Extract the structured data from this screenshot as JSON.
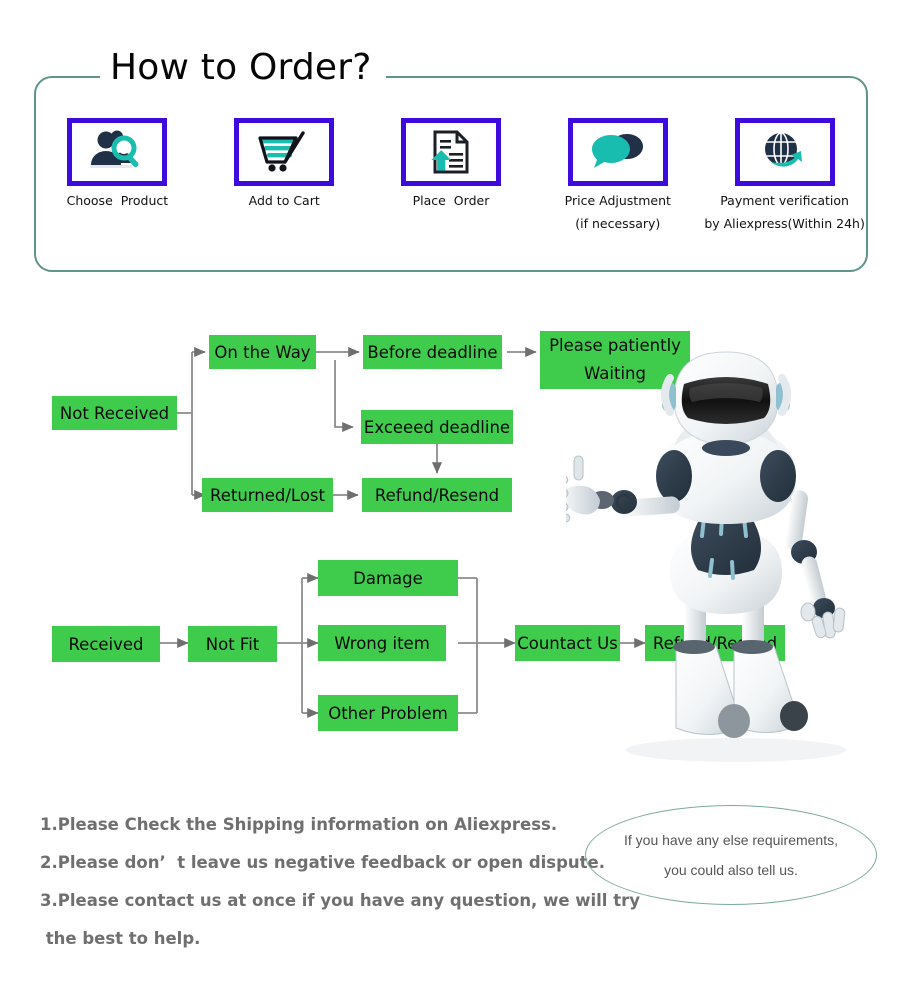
{
  "header": {
    "title": "How to Order?",
    "border_color": "#5f938c",
    "steps": [
      {
        "icon": "person-search-icon",
        "label": "Choose  Product",
        "sub": ""
      },
      {
        "icon": "shopping-cart-icon",
        "label": "Add to Cart",
        "sub": ""
      },
      {
        "icon": "document-upload-icon",
        "label": "Place  Order",
        "sub": ""
      },
      {
        "icon": "chat-bubbles-icon",
        "label": "Price Adjustment",
        "sub": "(if necessary)"
      },
      {
        "icon": "globe-arrow-icon",
        "label": "Payment verification",
        "sub": "by Aliexpress(Within 24h)"
      }
    ],
    "frame_color": "#3d0bdd",
    "icon_accent": "#19bdb0",
    "icon_dark": "#203046"
  },
  "flow": {
    "node_color": "#3fcb4c",
    "wire_color": "#8c8c8c",
    "not_received": {
      "root": "Not Received",
      "on_the_way": "On the Way",
      "before_deadline": "Before deadline",
      "please_wait": "Please patiently\nWaiting",
      "exceed_deadline": "Exceeed deadline",
      "returned_lost": "Returned/Lost",
      "refund_resend": "Refund/Resend"
    },
    "received": {
      "root": "Received",
      "not_fit": "Not Fit",
      "damage": "Damage",
      "wrong_item": "Wrong item",
      "other_problem": "Other Problem",
      "contact_us": "Countact Us",
      "refund_resend": "Refund/Resend"
    }
  },
  "notes": [
    "1.Please Check the Shipping information on Aliexpress.",
    "2.Please don’  t leave us negative feedback or open dispute.",
    "3.Please contact us at once if you have any question, we will try",
    " the best to help."
  ],
  "bubble": {
    "line1": "If you have any else requirements,",
    "line2": "you could also tell us.",
    "border_color": "#7aab9f"
  },
  "robot": {
    "alt": "3d-robot-illustration",
    "body_color": "#f4f6f8",
    "joint_color": "#2f3d4c",
    "accent_color": "#7fb6c6"
  }
}
